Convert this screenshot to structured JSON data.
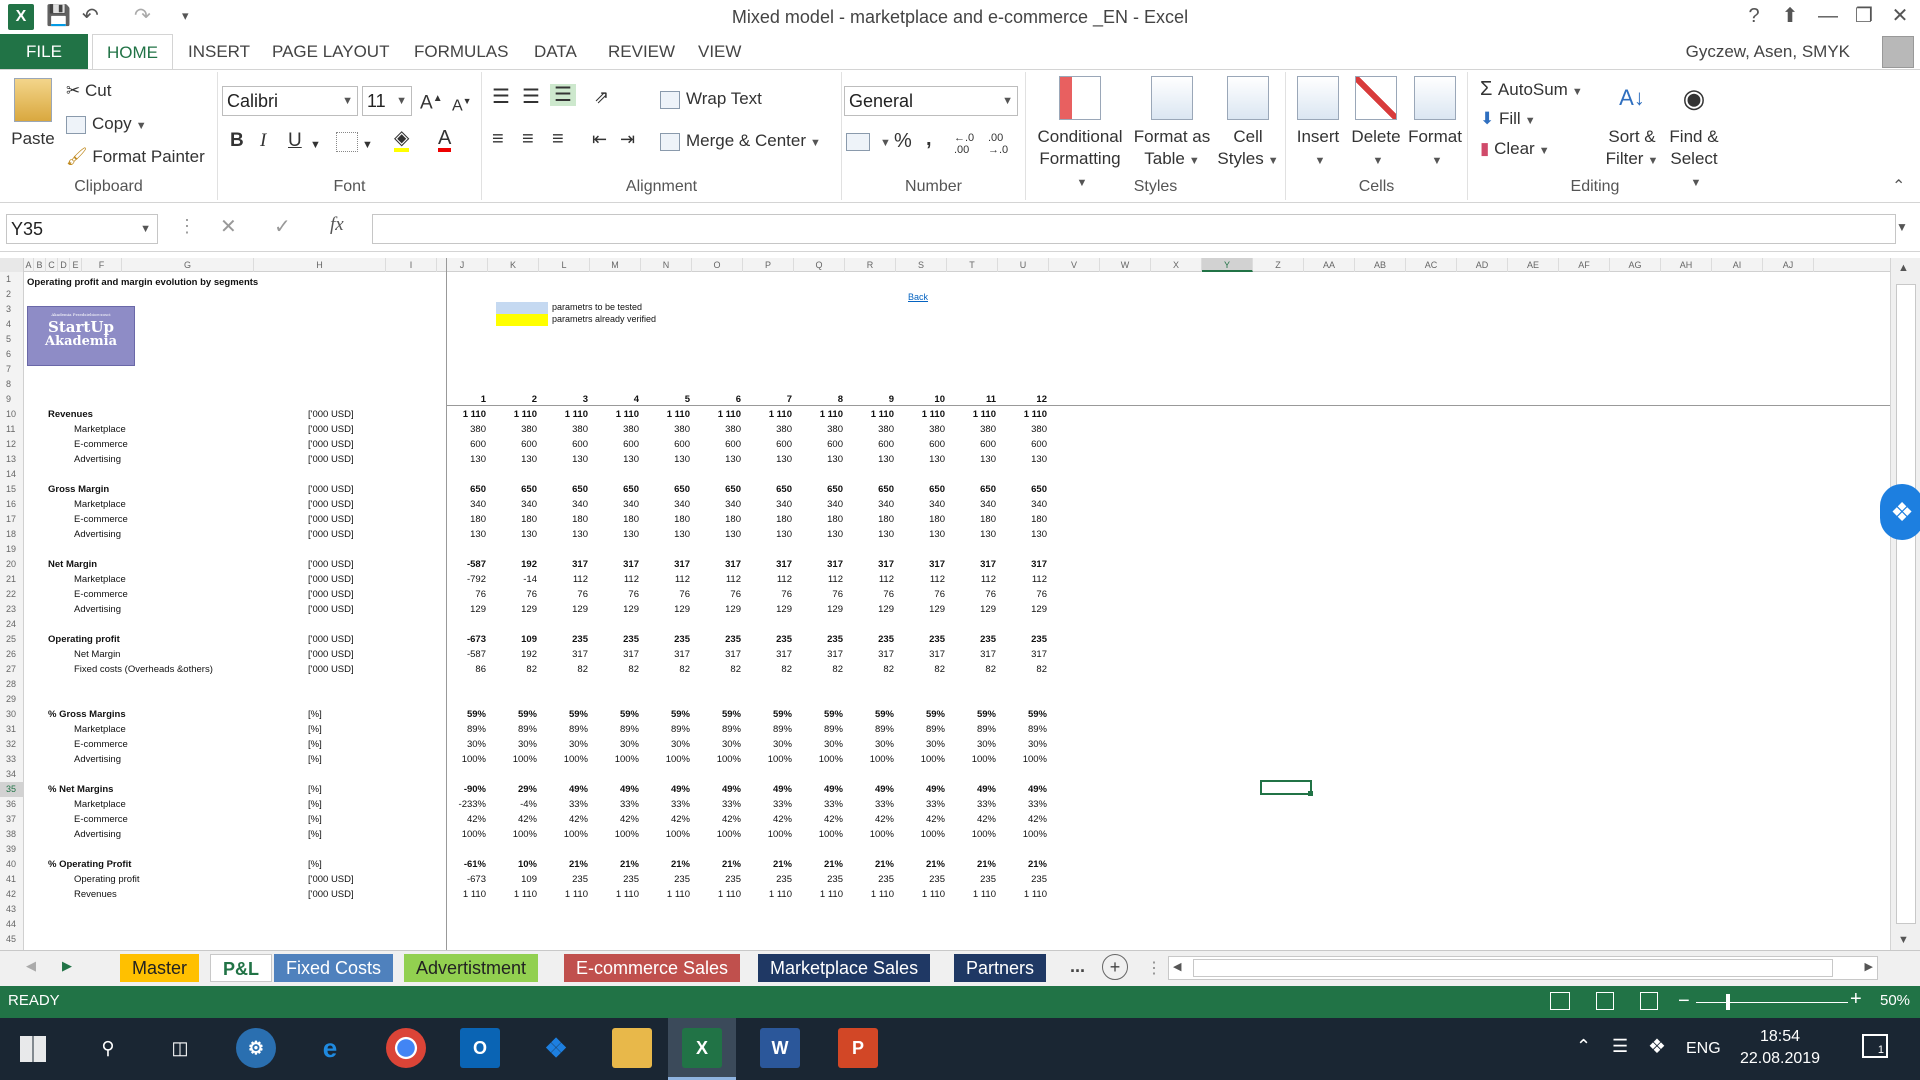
{
  "window": {
    "title": "Mixed model - marketplace and e-commerce _EN - Excel",
    "help": "?"
  },
  "tabs": {
    "file": "FILE",
    "items": [
      "HOME",
      "INSERT",
      "PAGE LAYOUT",
      "FORMULAS",
      "DATA",
      "REVIEW",
      "VIEW"
    ],
    "user": "Gyczew, Asen, SMYK"
  },
  "ribbon": {
    "clipboard": {
      "paste": "Paste",
      "cut": "Cut",
      "copy": "Copy",
      "format_painter": "Format Painter",
      "label": "Clipboard"
    },
    "font": {
      "name": "Calibri",
      "size": "11",
      "bold": "B",
      "italic": "I",
      "underline": "U",
      "label": "Font"
    },
    "alignment": {
      "wrap": "Wrap Text",
      "merge": "Merge & Center",
      "label": "Alignment"
    },
    "number": {
      "format": "General",
      "percent": "%",
      "comma": ",",
      "label": "Number"
    },
    "styles": {
      "conditional": [
        "Conditional",
        "Formatting"
      ],
      "format_table": [
        "Format as",
        "Table"
      ],
      "cell_styles": [
        "Cell",
        "Styles"
      ],
      "label": "Styles"
    },
    "cells": {
      "insert": "Insert",
      "delete": "Delete",
      "format": "Format",
      "label": "Cells"
    },
    "editing": {
      "autosum": "AutoSum",
      "fill": "Fill",
      "clear": "Clear",
      "sort": [
        "Sort &",
        "Filter"
      ],
      "find": [
        "Find &",
        "Select"
      ],
      "label": "Editing"
    }
  },
  "formula_bar": {
    "name_box": "Y35",
    "fx": "fx",
    "value": ""
  },
  "columns": [
    "A",
    "B",
    "C",
    "D",
    "E",
    "F",
    "G",
    "H",
    "I",
    "J",
    "K",
    "L",
    "M",
    "N",
    "O",
    "P",
    "Q",
    "R",
    "S",
    "T",
    "U",
    "V",
    "W",
    "X",
    "Y",
    "Z",
    "AA",
    "AB",
    "AC",
    "AD",
    "AE",
    "AF",
    "AG",
    "AH",
    "AI",
    "AJ"
  ],
  "sheet": {
    "title": "Operating profit and margin evolution by segments",
    "logo": {
      "top": "Akademia Przedsiebiorczosci",
      "line1": "StartUp",
      "line2": "Akademia"
    },
    "legend": [
      "parametrs to be tested",
      "parametrs already verified"
    ],
    "legend_colors": [
      "#c5d9f1",
      "#ffff00"
    ],
    "back": "Back",
    "months": [
      "1",
      "2",
      "3",
      "4",
      "5",
      "6",
      "7",
      "8",
      "9",
      "10",
      "11",
      "12"
    ],
    "rows": [
      {
        "r": 10,
        "label": "Revenues",
        "bold": true,
        "indent": 0,
        "unit": "['000 USD]",
        "vals": [
          "1 110",
          "1 110",
          "1 110",
          "1 110",
          "1 110",
          "1 110",
          "1 110",
          "1 110",
          "1 110",
          "1 110",
          "1 110",
          "1 110"
        ]
      },
      {
        "r": 11,
        "label": "Marketplace",
        "indent": 1,
        "unit": "['000 USD]",
        "vals": [
          "380",
          "380",
          "380",
          "380",
          "380",
          "380",
          "380",
          "380",
          "380",
          "380",
          "380",
          "380"
        ]
      },
      {
        "r": 12,
        "label": "E-commerce",
        "indent": 1,
        "unit": "['000 USD]",
        "vals": [
          "600",
          "600",
          "600",
          "600",
          "600",
          "600",
          "600",
          "600",
          "600",
          "600",
          "600",
          "600"
        ]
      },
      {
        "r": 13,
        "label": "Advertising",
        "indent": 1,
        "unit": "['000 USD]",
        "vals": [
          "130",
          "130",
          "130",
          "130",
          "130",
          "130",
          "130",
          "130",
          "130",
          "130",
          "130",
          "130"
        ]
      },
      {
        "r": 15,
        "label": "Gross Margin",
        "bold": true,
        "indent": 0,
        "unit": "['000 USD]",
        "vals": [
          "650",
          "650",
          "650",
          "650",
          "650",
          "650",
          "650",
          "650",
          "650",
          "650",
          "650",
          "650"
        ]
      },
      {
        "r": 16,
        "label": "Marketplace",
        "indent": 1,
        "unit": "['000 USD]",
        "vals": [
          "340",
          "340",
          "340",
          "340",
          "340",
          "340",
          "340",
          "340",
          "340",
          "340",
          "340",
          "340"
        ]
      },
      {
        "r": 17,
        "label": "E-commerce",
        "indent": 1,
        "unit": "['000 USD]",
        "vals": [
          "180",
          "180",
          "180",
          "180",
          "180",
          "180",
          "180",
          "180",
          "180",
          "180",
          "180",
          "180"
        ]
      },
      {
        "r": 18,
        "label": "Advertising",
        "indent": 1,
        "unit": "['000 USD]",
        "vals": [
          "130",
          "130",
          "130",
          "130",
          "130",
          "130",
          "130",
          "130",
          "130",
          "130",
          "130",
          "130"
        ]
      },
      {
        "r": 20,
        "label": "Net Margin",
        "bold": true,
        "indent": 0,
        "unit": "['000 USD]",
        "vals": [
          "-587",
          "192",
          "317",
          "317",
          "317",
          "317",
          "317",
          "317",
          "317",
          "317",
          "317",
          "317"
        ]
      },
      {
        "r": 21,
        "label": "Marketplace",
        "indent": 1,
        "unit": "['000 USD]",
        "vals": [
          "-792",
          "-14",
          "112",
          "112",
          "112",
          "112",
          "112",
          "112",
          "112",
          "112",
          "112",
          "112"
        ]
      },
      {
        "r": 22,
        "label": "E-commerce",
        "indent": 1,
        "unit": "['000 USD]",
        "vals": [
          "76",
          "76",
          "76",
          "76",
          "76",
          "76",
          "76",
          "76",
          "76",
          "76",
          "76",
          "76"
        ]
      },
      {
        "r": 23,
        "label": "Advertising",
        "indent": 1,
        "unit": "['000 USD]",
        "vals": [
          "129",
          "129",
          "129",
          "129",
          "129",
          "129",
          "129",
          "129",
          "129",
          "129",
          "129",
          "129"
        ]
      },
      {
        "r": 25,
        "label": "Operating profit",
        "bold": true,
        "indent": 0,
        "unit": "['000 USD]",
        "vals": [
          "-673",
          "109",
          "235",
          "235",
          "235",
          "235",
          "235",
          "235",
          "235",
          "235",
          "235",
          "235"
        ]
      },
      {
        "r": 26,
        "label": "Net Margin",
        "indent": 1,
        "unit": "['000 USD]",
        "vals": [
          "-587",
          "192",
          "317",
          "317",
          "317",
          "317",
          "317",
          "317",
          "317",
          "317",
          "317",
          "317"
        ]
      },
      {
        "r": 27,
        "label": "Fixed costs (Overheads &others)",
        "indent": 1,
        "unit": "['000 USD]",
        "vals": [
          "86",
          "82",
          "82",
          "82",
          "82",
          "82",
          "82",
          "82",
          "82",
          "82",
          "82",
          "82"
        ]
      },
      {
        "r": 30,
        "label": "% Gross Margins",
        "bold": true,
        "indent": 0,
        "unit": "[%]",
        "vals": [
          "59%",
          "59%",
          "59%",
          "59%",
          "59%",
          "59%",
          "59%",
          "59%",
          "59%",
          "59%",
          "59%",
          "59%"
        ]
      },
      {
        "r": 31,
        "label": "Marketplace",
        "indent": 1,
        "unit": "[%]",
        "vals": [
          "89%",
          "89%",
          "89%",
          "89%",
          "89%",
          "89%",
          "89%",
          "89%",
          "89%",
          "89%",
          "89%",
          "89%"
        ]
      },
      {
        "r": 32,
        "label": "E-commerce",
        "indent": 1,
        "unit": "[%]",
        "vals": [
          "30%",
          "30%",
          "30%",
          "30%",
          "30%",
          "30%",
          "30%",
          "30%",
          "30%",
          "30%",
          "30%",
          "30%"
        ]
      },
      {
        "r": 33,
        "label": "Advertising",
        "indent": 1,
        "unit": "[%]",
        "vals": [
          "100%",
          "100%",
          "100%",
          "100%",
          "100%",
          "100%",
          "100%",
          "100%",
          "100%",
          "100%",
          "100%",
          "100%"
        ]
      },
      {
        "r": 35,
        "label": "% Net Margins",
        "bold": true,
        "indent": 0,
        "unit": "[%]",
        "vals": [
          "-90%",
          "29%",
          "49%",
          "49%",
          "49%",
          "49%",
          "49%",
          "49%",
          "49%",
          "49%",
          "49%",
          "49%"
        ]
      },
      {
        "r": 36,
        "label": "Marketplace",
        "indent": 1,
        "unit": "[%]",
        "vals": [
          "-233%",
          "-4%",
          "33%",
          "33%",
          "33%",
          "33%",
          "33%",
          "33%",
          "33%",
          "33%",
          "33%",
          "33%"
        ]
      },
      {
        "r": 37,
        "label": "E-commerce",
        "indent": 1,
        "unit": "[%]",
        "vals": [
          "42%",
          "42%",
          "42%",
          "42%",
          "42%",
          "42%",
          "42%",
          "42%",
          "42%",
          "42%",
          "42%",
          "42%"
        ]
      },
      {
        "r": 38,
        "label": "Advertising",
        "indent": 1,
        "unit": "[%]",
        "vals": [
          "100%",
          "100%",
          "100%",
          "100%",
          "100%",
          "100%",
          "100%",
          "100%",
          "100%",
          "100%",
          "100%",
          "100%"
        ]
      },
      {
        "r": 40,
        "label": "% Operating Profit",
        "bold": true,
        "indent": 0,
        "unit": "[%]",
        "vals": [
          "-61%",
          "10%",
          "21%",
          "21%",
          "21%",
          "21%",
          "21%",
          "21%",
          "21%",
          "21%",
          "21%",
          "21%"
        ]
      },
      {
        "r": 41,
        "label": "Operating profit",
        "indent": 1,
        "unit": "['000 USD]",
        "vals": [
          "-673",
          "109",
          "235",
          "235",
          "235",
          "235",
          "235",
          "235",
          "235",
          "235",
          "235",
          "235"
        ]
      },
      {
        "r": 42,
        "label": "Revenues",
        "indent": 1,
        "unit": "['000 USD]",
        "vals": [
          "1 110",
          "1 110",
          "1 110",
          "1 110",
          "1 110",
          "1 110",
          "1 110",
          "1 110",
          "1 110",
          "1 110",
          "1 110",
          "1 110"
        ]
      }
    ]
  },
  "sheet_tabs": [
    {
      "name": "Master",
      "color": "#ffc000",
      "text": "#222"
    },
    {
      "name": "P&L",
      "color": "#ffffff",
      "text": "#217346",
      "active": true
    },
    {
      "name": "Fixed Costs",
      "color": "#4f81bd",
      "text": "#fff"
    },
    {
      "name": "Advertistment",
      "color": "#92d050",
      "text": "#222"
    },
    {
      "name": "E-commerce Sales",
      "color": "#c0504d",
      "text": "#fff"
    },
    {
      "name": "Marketplace Sales",
      "color": "#1f3864",
      "text": "#fff"
    },
    {
      "name": "Partners",
      "color": "#1f3864",
      "text": "#fff"
    }
  ],
  "status": {
    "ready": "READY",
    "zoom": "50%"
  },
  "taskbar": {
    "lang": "ENG",
    "time": "18:54",
    "date": "22.08.2019",
    "notif": "1"
  }
}
